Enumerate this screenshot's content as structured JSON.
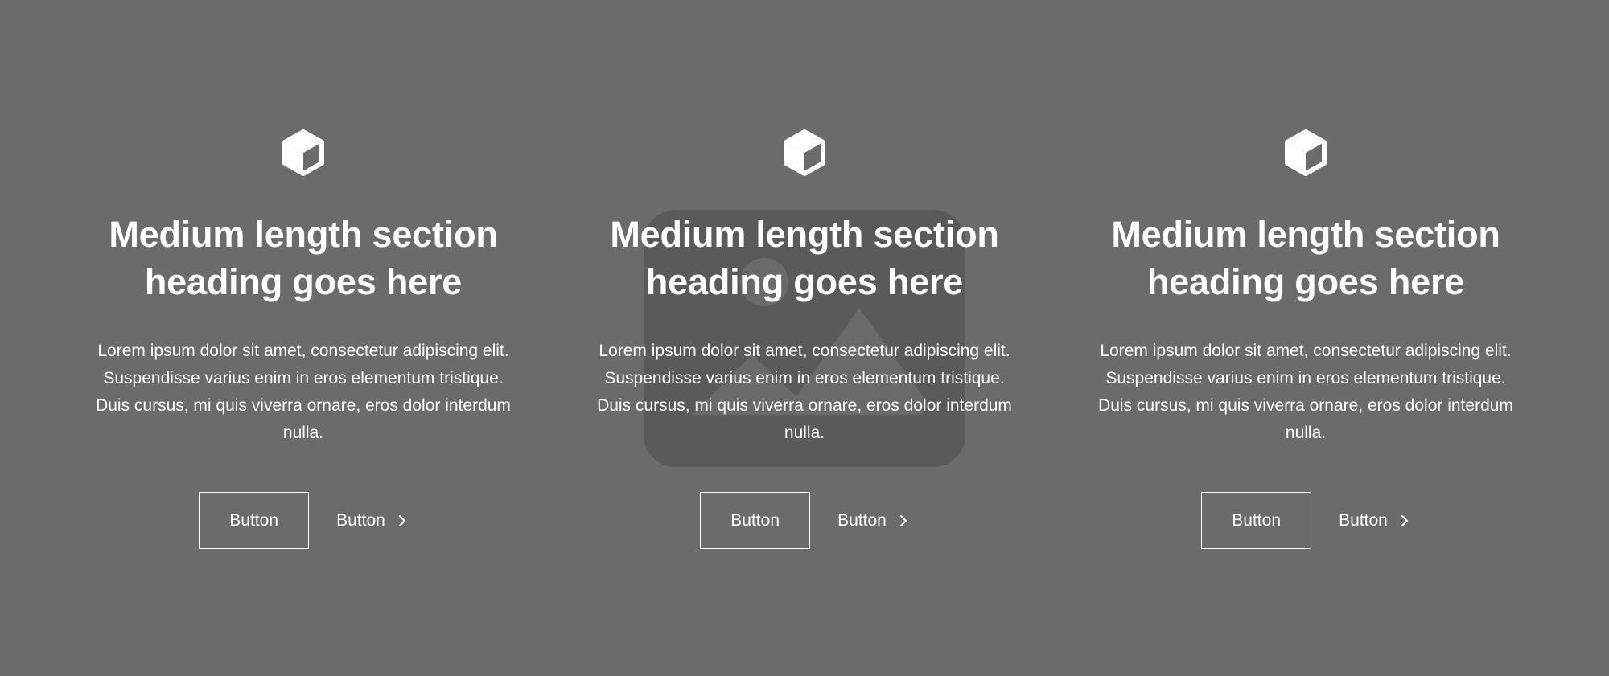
{
  "theme": {
    "background": "#6b6b6b",
    "placeholder_fill": "#5a5a5a",
    "text_color": "#ffffff"
  },
  "background_image": {
    "icon": "image-placeholder-icon"
  },
  "features": [
    {
      "icon": "cube-icon",
      "heading_line1": "Medium length section",
      "heading_line2": "heading goes here",
      "body_line1": "Lorem ipsum dolor sit amet, consectetur adipiscing elit.",
      "body_line2": "Suspendisse varius enim in eros elementum tristique.",
      "body_line3": "Duis cursus, mi quis viverra ornare, eros dolor interdum",
      "body_line4": "nulla.",
      "primary_button": "Button",
      "link_button": "Button",
      "link_icon": "chevron-right-icon"
    },
    {
      "icon": "cube-icon",
      "heading_line1": "Medium length section",
      "heading_line2": "heading goes here",
      "body_line1": "Lorem ipsum dolor sit amet, consectetur adipiscing elit.",
      "body_line2": "Suspendisse varius enim in eros elementum tristique.",
      "body_line3": "Duis cursus, mi quis viverra ornare, eros dolor interdum",
      "body_line4": "nulla.",
      "primary_button": "Button",
      "link_button": "Button",
      "link_icon": "chevron-right-icon"
    },
    {
      "icon": "cube-icon",
      "heading_line1": "Medium length section",
      "heading_line2": "heading goes here",
      "body_line1": "Lorem ipsum dolor sit amet, consectetur adipiscing elit.",
      "body_line2": "Suspendisse varius enim in eros elementum tristique.",
      "body_line3": "Duis cursus, mi quis viverra ornare, eros dolor interdum",
      "body_line4": "nulla.",
      "primary_button": "Button",
      "link_button": "Button",
      "link_icon": "chevron-right-icon"
    }
  ]
}
